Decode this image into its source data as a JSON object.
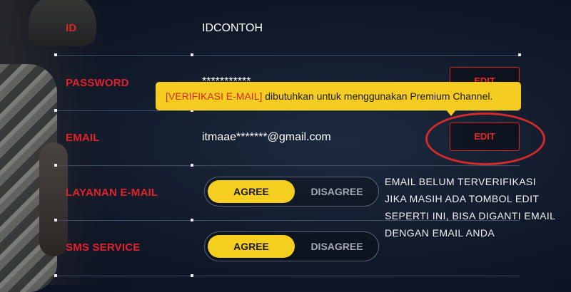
{
  "rows": {
    "id": {
      "label": "ID",
      "value": "IDCONTOH"
    },
    "password": {
      "label": "PASSWORD",
      "value": "***********",
      "edit_label": "EDIT"
    },
    "email": {
      "label": "EMAIL",
      "value": "itmaae*******@gmail.com",
      "edit_label": "EDIT"
    },
    "email_service": {
      "label": "LAYANAN E-MAIL",
      "agree": "AGREE",
      "disagree": "DISAGREE",
      "selected": "AGREE"
    },
    "sms_service": {
      "label": "SMS SERVICE",
      "agree": "AGREE",
      "disagree": "DISAGREE",
      "selected": "AGREE"
    }
  },
  "tooltip": {
    "tag": "[VERIFIKASI E-MAIL]",
    "message": " dibutuhkan untuk menggunakan Premium Channel."
  },
  "annotation": {
    "lines": [
      "EMAIL BELUM TERVERIFIKASI",
      "JIKA MASIH ADA TOMBOL EDIT",
      "SEPERTI INI, BISA DIGANTI EMAIL",
      "DENGAN EMAIL ANDA"
    ]
  },
  "colors": {
    "label_red": "#e1222a",
    "accent_yellow": "#f4cf1f",
    "highlight_circle": "#d42a2a"
  }
}
